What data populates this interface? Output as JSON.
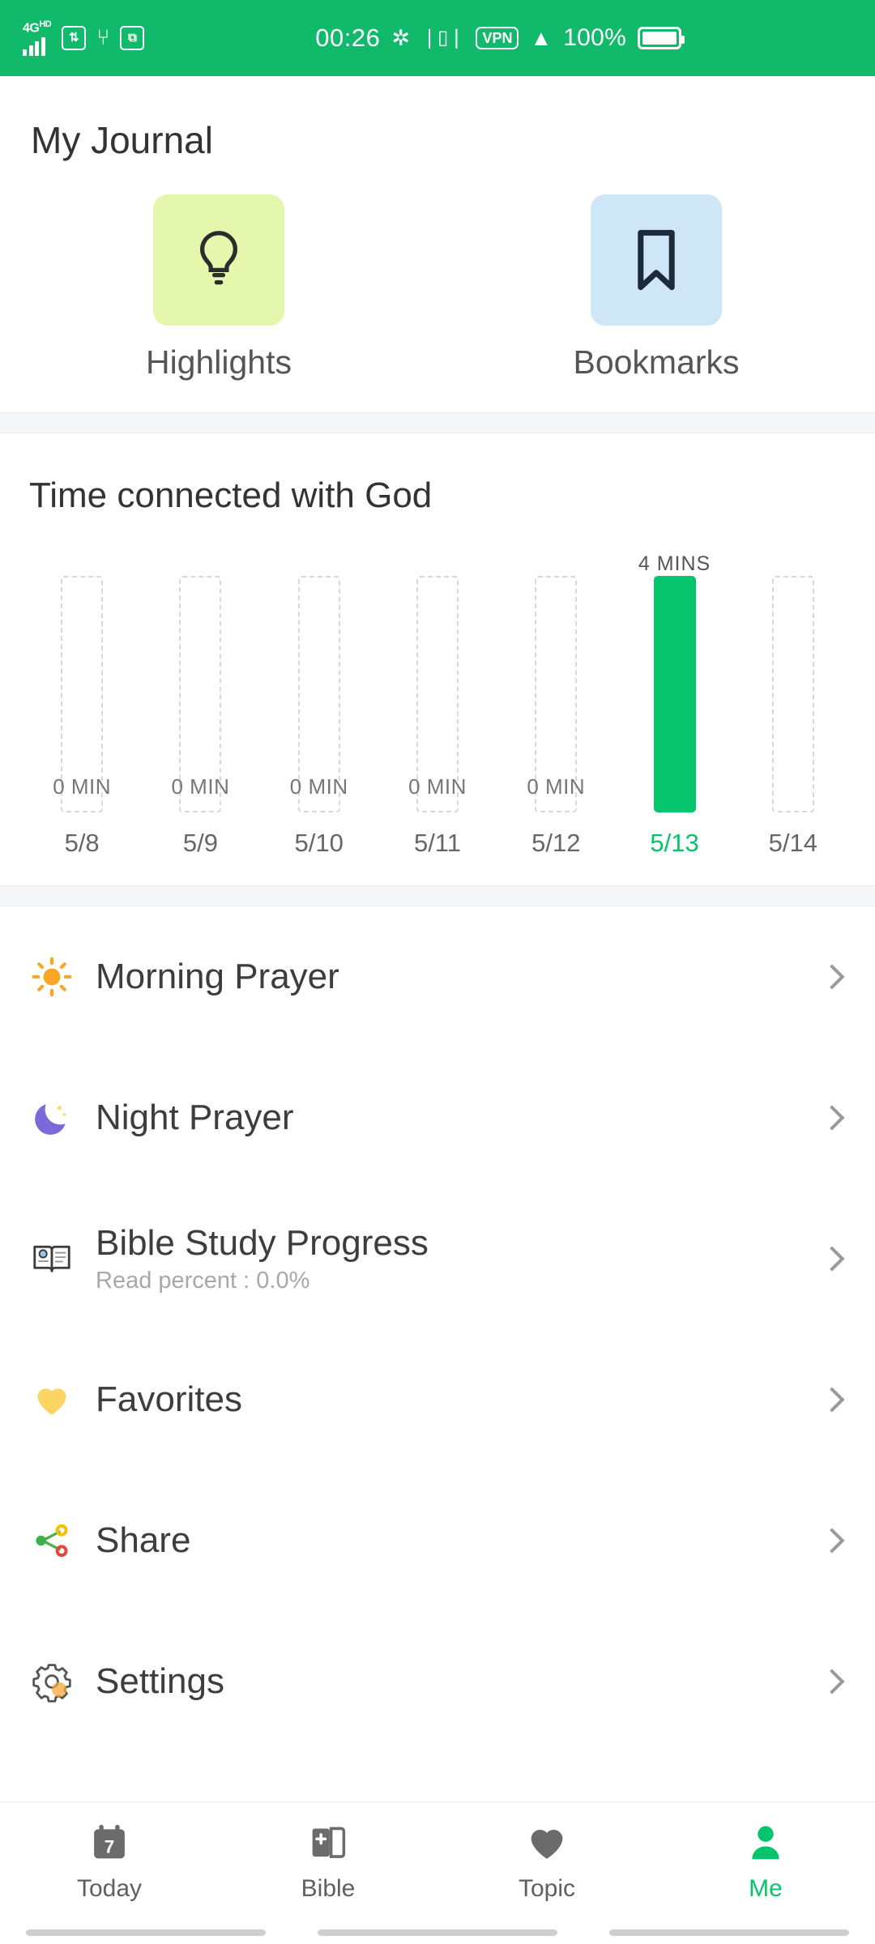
{
  "status_bar": {
    "network_label": "4G",
    "network_badge": "HD",
    "sim_icon": "sim-card-icon",
    "usb_icon": "usb-icon",
    "screenshot_icon": "screenshot-icon",
    "time": "00:26",
    "bluetooth_icon": "bluetooth-icon",
    "vibrate_icon": "vibrate-icon",
    "vpn_label": "VPN",
    "wifi_icon": "wifi-icon",
    "battery_percent": "100%",
    "battery_icon": "battery-full-icon",
    "background_color": "#11b96b"
  },
  "header": {
    "title": "My Journal"
  },
  "journal": {
    "shortcuts": [
      {
        "label": "Highlights",
        "icon": "lightbulb-icon",
        "tile_color": "#e4f7ac"
      },
      {
        "label": "Bookmarks",
        "icon": "bookmark-icon",
        "tile_color": "#cfe6f7"
      }
    ]
  },
  "chart_section": {
    "title": "Time connected with God"
  },
  "chart_data": {
    "type": "bar",
    "title": "Time connected with God",
    "xlabel": "",
    "ylabel": "Minutes",
    "categories": [
      "5/8",
      "5/9",
      "5/10",
      "5/11",
      "5/12",
      "5/13",
      "5/14"
    ],
    "values": [
      0,
      0,
      0,
      0,
      0,
      4,
      0
    ],
    "value_labels": [
      "0 MIN",
      "0 MIN",
      "0 MIN",
      "0 MIN",
      "0 MIN",
      "4 MINS",
      ""
    ],
    "highlighted_index": 5,
    "highlight_color": "#05c46b",
    "empty_bar_style": "dashed-outline",
    "ylim": [
      0,
      4
    ],
    "grid": false,
    "legend": false
  },
  "menu": {
    "items": [
      {
        "label": "Morning Prayer",
        "sub": "",
        "icon": "sun-icon"
      },
      {
        "label": "Night Prayer",
        "sub": "",
        "icon": "crescent-moon-icon"
      },
      {
        "label": "Bible Study Progress",
        "sub": "Read percent : 0.0%",
        "icon": "open-book-icon"
      },
      {
        "label": "Favorites",
        "sub": "",
        "icon": "heart-icon"
      },
      {
        "label": "Share",
        "sub": "",
        "icon": "share-nodes-icon"
      },
      {
        "label": "Settings",
        "sub": "",
        "icon": "gear-icon"
      }
    ]
  },
  "bottom_nav": {
    "active_color": "#05c46b",
    "items": [
      {
        "label": "Today",
        "icon": "calendar-icon",
        "badge": "7",
        "active": false
      },
      {
        "label": "Bible",
        "icon": "book-plus-icon",
        "active": false
      },
      {
        "label": "Topic",
        "icon": "heart-filled-icon",
        "active": false
      },
      {
        "label": "Me",
        "icon": "person-icon",
        "active": true
      }
    ]
  }
}
